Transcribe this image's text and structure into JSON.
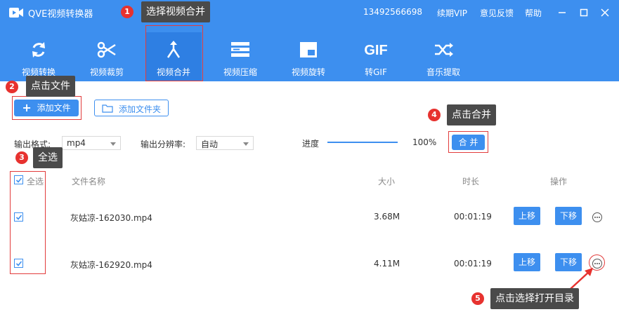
{
  "app": {
    "title": "QVE视频转换器",
    "phone": "13492566698",
    "vip": "续期VIP",
    "feedback": "意见反馈",
    "help": "帮助"
  },
  "nav": [
    {
      "label": "视频转换",
      "icon": "refresh-icon"
    },
    {
      "label": "视频裁剪",
      "icon": "scissors-icon"
    },
    {
      "label": "视频合并",
      "icon": "merge-icon",
      "active": true
    },
    {
      "label": "视频压缩",
      "icon": "compress-icon"
    },
    {
      "label": "视频旋转",
      "icon": "rotate-icon"
    },
    {
      "label": "转GIF",
      "icon": "gif-icon",
      "icon_text": "GIF"
    },
    {
      "label": "音乐提取",
      "icon": "shuffle-icon"
    }
  ],
  "toolbar": {
    "add_file": "添加文件",
    "add_folder": "添加文件夹"
  },
  "settings": {
    "format_label": "输出格式:",
    "format_value": "mp4",
    "resolution_label": "输出分辨率:",
    "resolution_value": "自动",
    "progress_label": "进度",
    "progress_value": "100%",
    "progress_fraction": 1.0,
    "merge_button": "合 并"
  },
  "table": {
    "headers": {
      "select_all": "全选",
      "name": "文件名称",
      "size": "大小",
      "duration": "时长",
      "actions": "操作"
    },
    "rows": [
      {
        "name": "灰姑凉-162030.mp4",
        "size": "3.68M",
        "duration": "00:01:19",
        "up": "上移",
        "down": "下移",
        "checked": true
      },
      {
        "name": "灰姑凉-162920.mp4",
        "size": "4.11M",
        "duration": "00:01:19",
        "up": "上移",
        "down": "下移",
        "checked": true
      }
    ]
  },
  "callouts": [
    {
      "num": "1",
      "text": "选择视频合并"
    },
    {
      "num": "2",
      "text": "点击文件"
    },
    {
      "num": "3",
      "text": "全选"
    },
    {
      "num": "4",
      "text": "点击合并"
    },
    {
      "num": "5",
      "text": "点击选择打开目录"
    }
  ],
  "colors": {
    "accent": "#3d8fef",
    "annotation_red": "#e7322f",
    "tooltip_bg": "#4a4a4a"
  }
}
